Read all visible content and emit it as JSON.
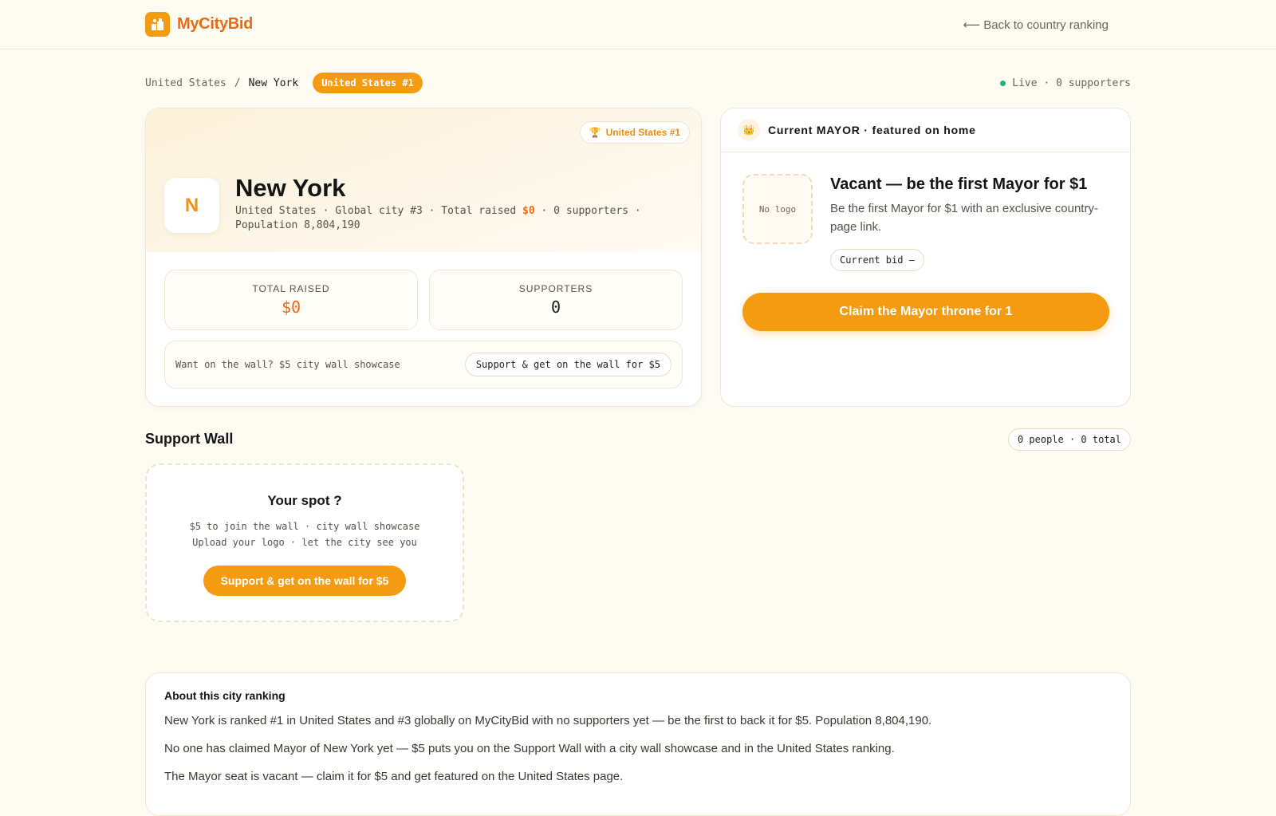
{
  "header": {
    "brand": "MyCityBid",
    "back_link": "⟵ Back to country ranking"
  },
  "breadcrumb": {
    "country": "United States",
    "separator": "/",
    "city": "New York",
    "rank_pill": "United States #1"
  },
  "live_status": "Live · 0 supporters",
  "city_card": {
    "badge": "United States #1",
    "avatar_letter": "N",
    "title": "New York",
    "meta_prefix": "United States · Global city #3 · Total raised ",
    "meta_money": "$0",
    "meta_suffix": " · 0 supporters · Population 8,804,190",
    "stats": [
      {
        "label": "TOTAL RAISED",
        "value": "$0"
      },
      {
        "label": "SUPPORTERS",
        "value": "0"
      }
    ],
    "wall_prompt": "Want on the wall? $5 city wall showcase",
    "wall_button": "Support & get on the wall for $5"
  },
  "mayor_card": {
    "header": "Current MAYOR · featured on home",
    "no_logo": "No logo",
    "title": "Vacant — be the first Mayor for $1",
    "description": "Be the first Mayor for $1 with an exclusive country-page link.",
    "current_bid": "Current bid —",
    "claim_button": "Claim the Mayor throne for 1"
  },
  "support_wall": {
    "title": "Support Wall",
    "count": "0 people · 0 total",
    "spot_title": "Your spot ?",
    "spot_line_1": "$5 to join the wall · city wall showcase",
    "spot_line_2": "Upload your logo · let the city see you",
    "spot_button": "Support & get on the wall for $5"
  },
  "about": {
    "title": "About this city ranking",
    "paragraphs": [
      "New York is ranked #1 in United States and #3 globally on MyCityBid with no supporters yet — be the first to back it for $5. Population 8,804,190.",
      "No one has claimed Mayor of New York yet — $5 puts you on the Support Wall with a city wall showcase and in the United States ranking.",
      "The Mayor seat is vacant — claim it for $5 and get featured on the United States page."
    ]
  },
  "colors": {
    "accent": "#f59b12",
    "brand_text": "#ee6a12",
    "live": "#22b07d",
    "background": "#fdfbf2"
  }
}
